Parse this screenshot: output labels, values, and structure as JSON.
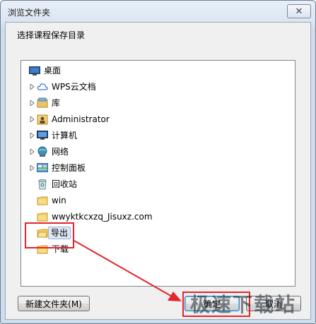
{
  "window": {
    "title": "浏览文件夹",
    "close_glyph": "✕"
  },
  "prompt": "选择课程保存目录",
  "tree": {
    "items": [
      {
        "label": "桌面",
        "icon": "desktop-icon"
      },
      {
        "label": "WPS云文档",
        "icon": "cloud-icon"
      },
      {
        "label": "库",
        "icon": "library-icon"
      },
      {
        "label": "Administrator",
        "icon": "user-folder-icon"
      },
      {
        "label": "计算机",
        "icon": "computer-icon"
      },
      {
        "label": "网络",
        "icon": "network-icon"
      },
      {
        "label": "控制面板",
        "icon": "control-panel-icon"
      },
      {
        "label": "回收站",
        "icon": "recycle-bin-icon"
      },
      {
        "label": "win",
        "icon": "folder-icon"
      },
      {
        "label": "wwyktkcxzq_Jisuxz.com",
        "icon": "folder-icon"
      },
      {
        "label": "导出",
        "icon": "folder-icon",
        "selected": true
      },
      {
        "label": "下载",
        "icon": "folder-icon"
      }
    ]
  },
  "buttons": {
    "new_folder": "新建文件夹(M)",
    "ok": "确定",
    "cancel": "取消"
  },
  "watermark": "极速下载站",
  "colors": {
    "annotation_red": "#e3262a",
    "selection": "#dde7f5"
  }
}
